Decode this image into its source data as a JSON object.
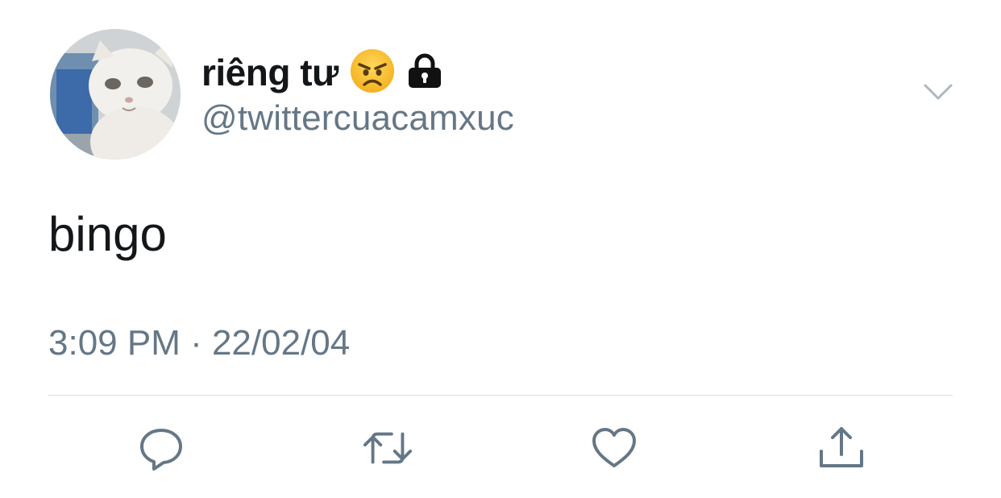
{
  "tweet": {
    "author": {
      "display_name": "riêng tư",
      "handle": "@twittercuacamxuc",
      "emoji_icon": "angry-face-icon",
      "protected_icon": "lock-icon"
    },
    "text": "bingo",
    "timestamp": "3:09 PM · 22/02/04",
    "menu_icon": "chevron-down-icon",
    "actions": [
      {
        "name": "reply",
        "icon": "reply-icon"
      },
      {
        "name": "retweet",
        "icon": "retweet-icon"
      },
      {
        "name": "like",
        "icon": "heart-icon"
      },
      {
        "name": "share",
        "icon": "share-icon"
      }
    ]
  },
  "colors": {
    "primary_text": "#14171a",
    "secondary_text": "#657786",
    "icon": "#657786",
    "divider": "#d6dde3",
    "background": "#ffffff"
  }
}
